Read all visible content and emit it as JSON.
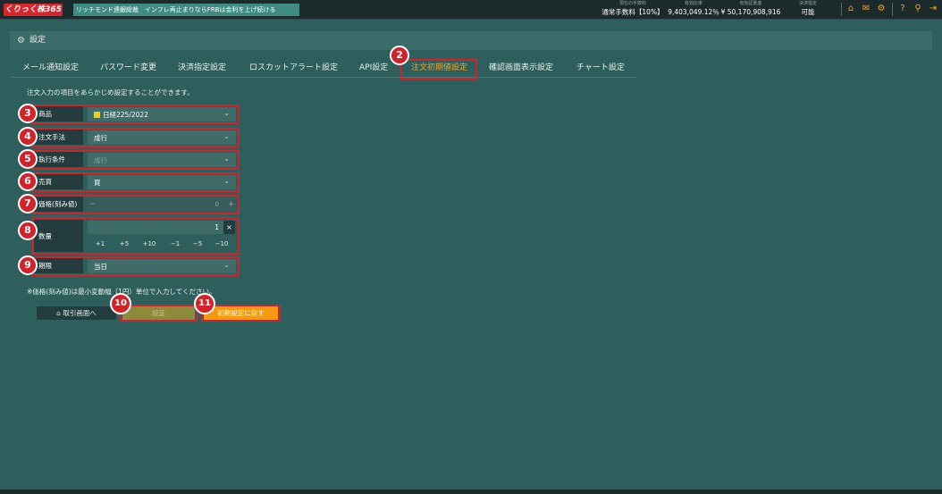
{
  "header": {
    "logo": "くりっく株365",
    "ticker": "リッチモンド連銀総裁　インフレ再止まりならFRBは金利を上げ続ける",
    "stats": [
      {
        "label": "現在の手数料",
        "value": "通常手数料【10%】"
      },
      {
        "label": "有効比率",
        "value": "9,403,049.12％"
      },
      {
        "label": "有効証拠金",
        "value": "¥ 50,170,908,916"
      },
      {
        "label": "決済指定",
        "value": "可能"
      }
    ]
  },
  "page": {
    "title": "設定",
    "description": "注文入力の項目をあらかじめ設定することができます。",
    "note": "※価格(刻み値)は最小変動幅（1円）単位で入力してください。"
  },
  "tabs": [
    {
      "label": "メール通知設定"
    },
    {
      "label": "パスワード変更"
    },
    {
      "label": "決済指定設定"
    },
    {
      "label": "ロスカットアラート設定"
    },
    {
      "label": "API設定"
    },
    {
      "label": "注文初期値設定"
    },
    {
      "label": "確認画面表示設定"
    },
    {
      "label": "チャート設定"
    }
  ],
  "form": {
    "product": {
      "label": "商品",
      "value": "日経225/2022"
    },
    "method": {
      "label": "注文手法",
      "value": "成行"
    },
    "condition": {
      "label": "執行条件",
      "value": "成行"
    },
    "side": {
      "label": "売買",
      "value": "買"
    },
    "price": {
      "label": "価格(刻み値)",
      "value": "0",
      "minus": "−",
      "plus": "+"
    },
    "quantity": {
      "label": "数量",
      "value": "1",
      "clear": "×",
      "steps": [
        "+1",
        "+5",
        "+10",
        "−1",
        "−5",
        "−10"
      ]
    },
    "expiry": {
      "label": "期限",
      "value": "当日"
    }
  },
  "buttons": {
    "back": "取引画面へ",
    "save": "設定",
    "reset": "初期設定に戻す"
  },
  "badges": [
    "2",
    "3",
    "4",
    "5",
    "6",
    "7",
    "8",
    "9",
    "10",
    "11"
  ],
  "colors": {
    "accent": "#f4a21c",
    "highlight": "#d2232a",
    "background": "#2f5f5c"
  }
}
